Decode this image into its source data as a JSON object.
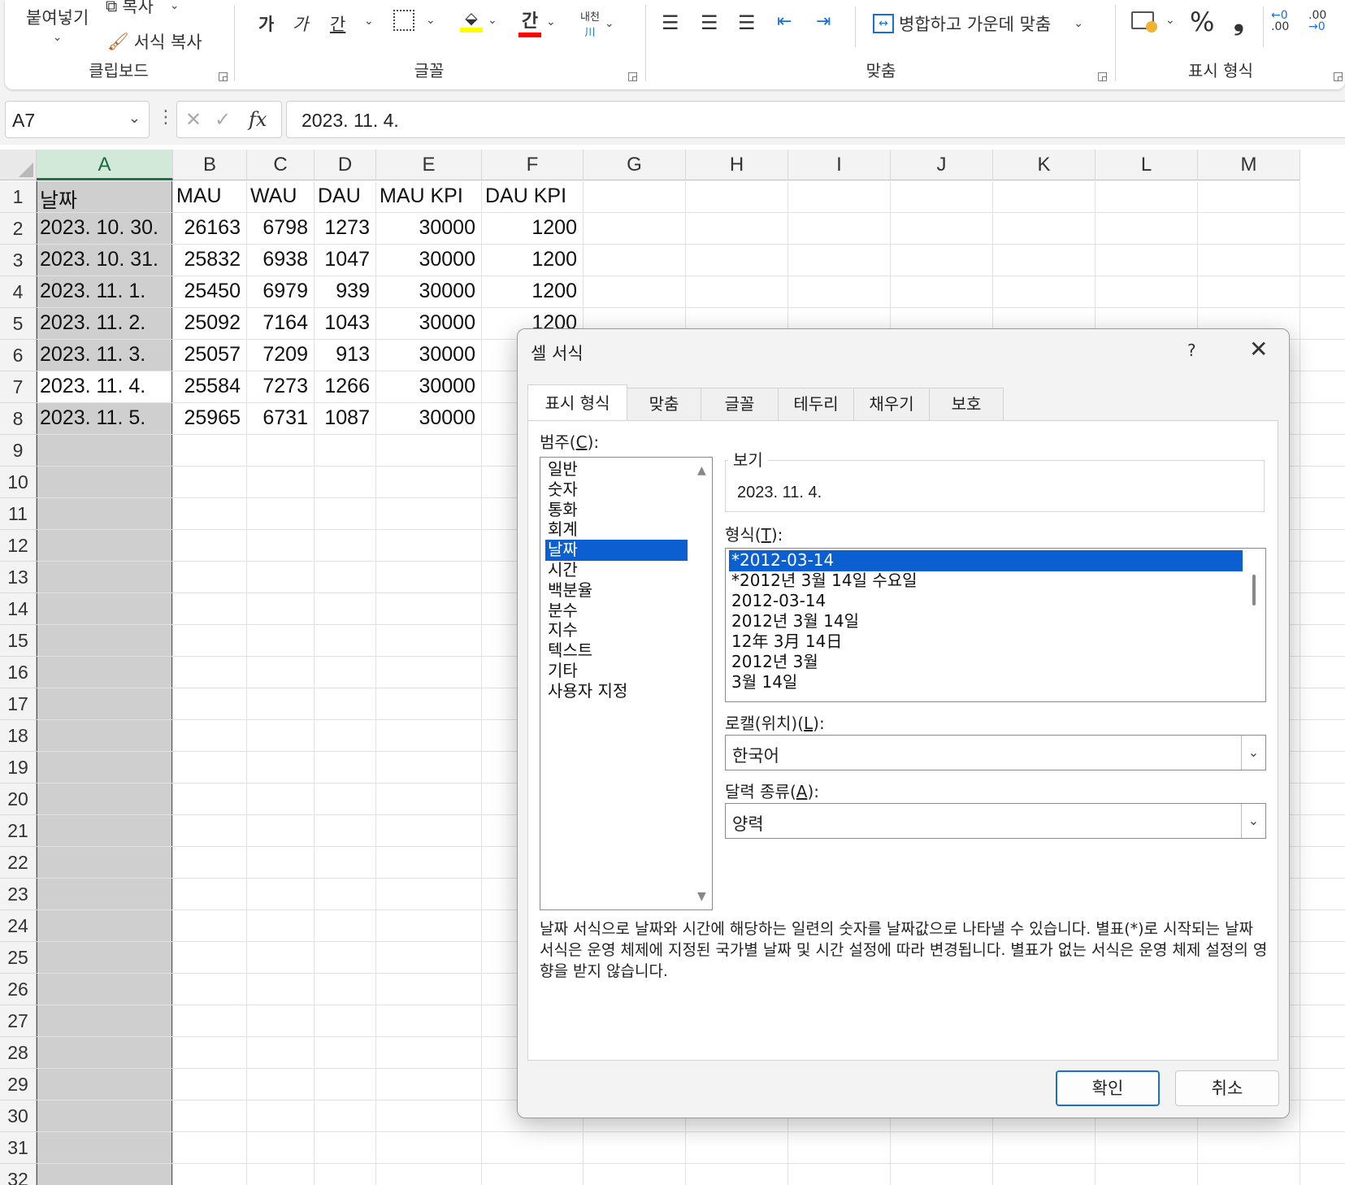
{
  "ribbon": {
    "clipboard": {
      "paste_label": "붙여넣기",
      "copy_label": "복사",
      "format_painter_label": "서식 복사",
      "group_label": "클립보드"
    },
    "font": {
      "bold_glyph": "가",
      "italic_glyph": "가",
      "underline_glyph": "간",
      "phonetic_glyph": "내천",
      "group_label": "글꼴",
      "fill_color": "#ffff00",
      "font_color": "#ff0000"
    },
    "alignment": {
      "merge_center_label": "병합하고 가운데 맞춤",
      "group_label": "맞춤"
    },
    "number": {
      "percent_glyph": "%",
      "comma_glyph": "❟",
      "increase_decimal_glyph": ".00",
      "decrease_decimal_glyph": ".00",
      "group_label": "표시 형식"
    }
  },
  "formula_bar": {
    "name_box": "A7",
    "fx_label": "fx",
    "value": "2023. 11. 4."
  },
  "sheet": {
    "columns": [
      "A",
      "B",
      "C",
      "D",
      "E",
      "F",
      "G",
      "H",
      "I",
      "J",
      "K",
      "L",
      "M"
    ],
    "row_numbers": [
      "1",
      "2",
      "3",
      "4",
      "5",
      "6",
      "7",
      "8",
      "9",
      "10",
      "11",
      "12",
      "13",
      "14",
      "15",
      "16",
      "17",
      "18",
      "19",
      "20",
      "21",
      "22",
      "23",
      "24",
      "25",
      "26",
      "27",
      "28",
      "29",
      "30",
      "31",
      "32"
    ],
    "headers": [
      "날짜",
      "MAU",
      "WAU",
      "DAU",
      "MAU KPI",
      "DAU KPI"
    ],
    "rows": [
      [
        "2023. 10. 30.",
        "26163",
        "6798",
        "1273",
        "30000",
        "1200"
      ],
      [
        "2023. 10. 31.",
        "25832",
        "6938",
        "1047",
        "30000",
        "1200"
      ],
      [
        "2023. 11. 1.",
        "25450",
        "6979",
        "939",
        "30000",
        "1200"
      ],
      [
        "2023. 11. 2.",
        "25092",
        "7164",
        "1043",
        "30000",
        "1200"
      ],
      [
        "2023. 11. 3.",
        "25057",
        "7209",
        "913",
        "30000",
        ""
      ],
      [
        "2023. 11. 4.",
        "25584",
        "7273",
        "1266",
        "30000",
        ""
      ],
      [
        "2023. 11. 5.",
        "25965",
        "6731",
        "1087",
        "30000",
        ""
      ]
    ],
    "active_cell": "A7",
    "selected_column": "A"
  },
  "dialog": {
    "title": "셀 서식",
    "help": "?",
    "tabs": [
      "표시 형식",
      "맞춤",
      "글꼴",
      "테두리",
      "채우기",
      "보호"
    ],
    "active_tab": "표시 형식",
    "category_label_prefix": "범주(",
    "category_label_key": "C",
    "category_label_suffix": "):",
    "categories": [
      "일반",
      "숫자",
      "통화",
      "회계",
      "날짜",
      "시간",
      "백분율",
      "분수",
      "지수",
      "텍스트",
      "기타",
      "사용자 지정"
    ],
    "selected_category": "날짜",
    "preview_label": "보기",
    "preview_value": "2023. 11. 4.",
    "type_label_prefix": "형식(",
    "type_label_key": "T",
    "type_label_suffix": "):",
    "formats": [
      "*2012-03-14",
      "*2012년 3월 14일 수요일",
      "2012-03-14",
      "2012년 3월 14일",
      "12年 3月 14日",
      "2012년 3월",
      "3월 14일"
    ],
    "selected_format": "*2012-03-14",
    "locale_label_prefix": "로캘(위치)(",
    "locale_label_key": "L",
    "locale_label_suffix": "):",
    "locale_value": "한국어",
    "calendar_label_prefix": "달력 종류(",
    "calendar_label_key": "A",
    "calendar_label_suffix": "):",
    "calendar_value": "양력",
    "description": "날짜 서식으로 날짜와 시간에 해당하는 일련의 숫자를 날짜값으로 나타낼 수 있습니다. 별표(*)로 시작되는 날짜 서식은 운영 체제에 지정된 국가별 날짜 및 시간 설정에 따라 변경됩니다. 별표가 없는 서식은 운영 체제 설정의 영향을 받지 않습니다.",
    "ok_label": "확인",
    "cancel_label": "취소"
  },
  "colors": {
    "selection_green": "#1e7145",
    "list_highlight": "#0b5fd0",
    "primary_button_border": "#1a6fd6"
  }
}
